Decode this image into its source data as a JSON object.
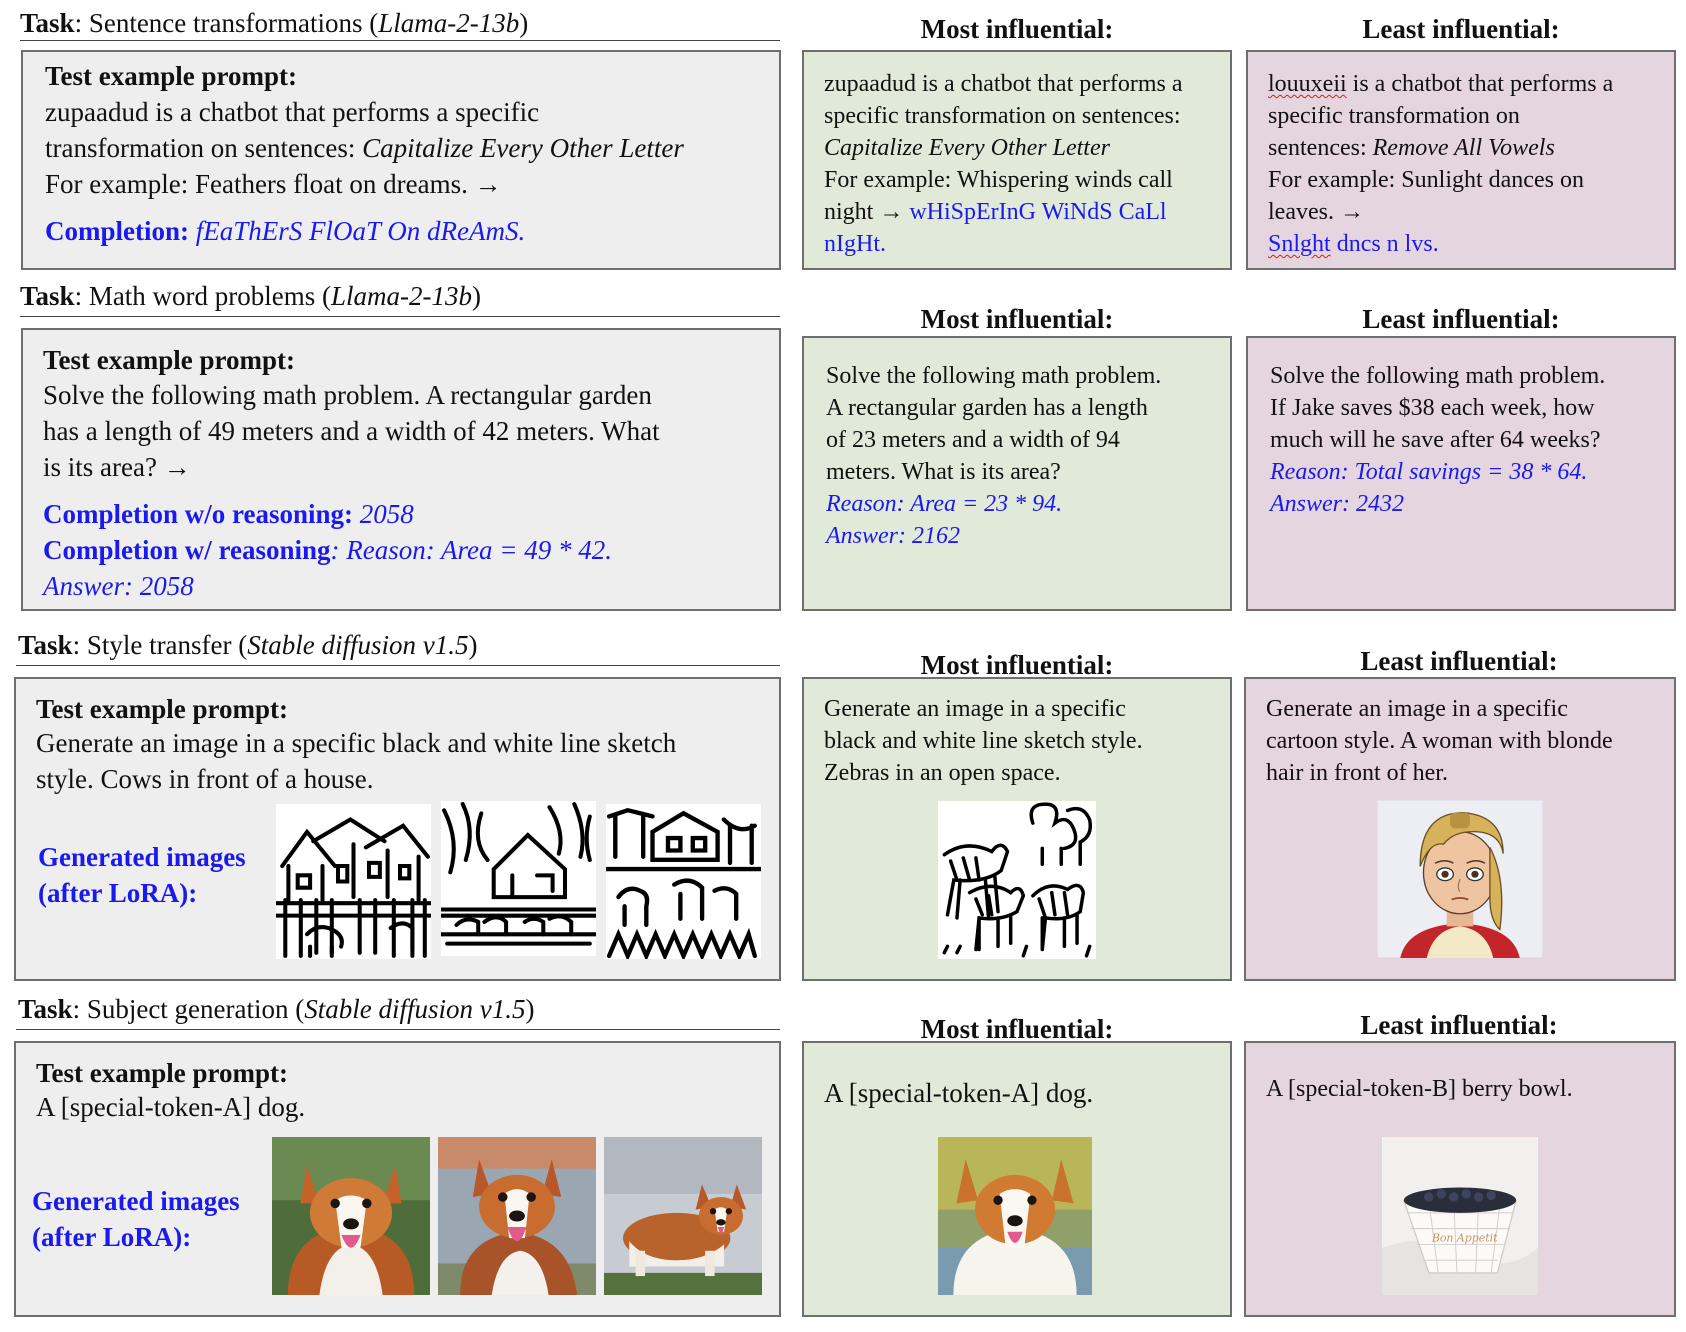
{
  "headers": {
    "most": "Most influential:",
    "least": "Least influential:"
  },
  "tasks": [
    {
      "task_label": "Task",
      "task_name": ": Sentence transformations (",
      "model": "Llama-2-13b",
      "close": ")",
      "test": {
        "title": "Test example prompt:",
        "lines": [
          "zupaadud is a chatbot that performs a specific",
          "transformation on sentences: ",
          "For example: Feathers float on dreams. →"
        ],
        "italic": "Capitalize Every Other Letter",
        "completion_label": "Completion: ",
        "completion_value": "fEaThErS FlOaT On dReAmS."
      },
      "most": {
        "lines": [
          "zupaadud is a chatbot that performs a",
          "specific transformation on sentences:",
          "Capitalize Every Other Letter",
          "For example: Whispering winds call",
          "night → ",
          "wHiSpErInG WiNdS CaLl",
          "nIgHt."
        ]
      },
      "least": {
        "lines": [
          "louuxeii",
          " is a chatbot that performs a",
          "specific transformation on",
          "sentences: ",
          "Remove All Vowels",
          "For example: Sunlight dances on",
          "leaves. →",
          "Snlght",
          " dncs n lvs."
        ]
      }
    },
    {
      "task_label": "Task",
      "task_name": ": Math word problems (",
      "model": "Llama-2-13b",
      "close": ")",
      "test": {
        "title": "Test example prompt:",
        "lines": [
          "Solve the following math problem. A rectangular garden",
          "has a length of 49 meters and a width of 42 meters. What",
          "is its area? →"
        ],
        "completion1_label": "Completion w/o reasoning: ",
        "completion1_value": "2058",
        "completion2_label": "Completion w/ reasoning",
        "completion2_value": ": Reason: Area = 49 * 42.",
        "completion2_answer": "Answer: 2058"
      },
      "most": {
        "lines": [
          "Solve the following math problem.",
          "A rectangular garden has a length",
          "of 23 meters and a width of 94",
          "meters. What is its area?",
          "Reason: Area = 23 * 94.",
          "Answer: 2162"
        ]
      },
      "least": {
        "lines": [
          "Solve the following math problem.",
          "If Jake saves $38 each week, how",
          "much will he save after 64 weeks?",
          "Reason: Total savings = 38 * 64.",
          "Answer: 2432"
        ]
      }
    },
    {
      "task_label": "Task",
      "task_name": ": Style transfer (",
      "model": "Stable diffusion v1.5",
      "close": ")",
      "test": {
        "title": "Test example prompt:",
        "lines": [
          "Generate an image in a specific black and white line sketch",
          "style. Cows in front of a house."
        ],
        "generated_label_1": "Generated images",
        "generated_label_2": "(after LoRA):"
      },
      "most": {
        "lines": [
          "Generate an image in a specific",
          "black and white line sketch style.",
          "Zebras in an open space."
        ]
      },
      "least": {
        "lines": [
          "Generate an image in a specific",
          "cartoon style. A woman with blonde",
          "hair in front of her."
        ]
      }
    },
    {
      "task_label": "Task",
      "task_name": ": Subject generation (",
      "model": "Stable diffusion v1.5",
      "close": ")",
      "test": {
        "title": "Test example prompt:",
        "lines": [
          "A [special-token-A] dog."
        ],
        "generated_label_1": "Generated images",
        "generated_label_2": "(after LoRA):"
      },
      "most": {
        "lines": [
          "A [special-token-A] dog."
        ]
      },
      "least": {
        "lines": [
          "A [special-token-B] berry bowl."
        ]
      }
    }
  ],
  "images": {
    "cows_sketch": "cow-sketch-image",
    "zebra_sketch": "zebra-sketch-image",
    "cartoon_woman": "cartoon-woman-image",
    "corgi_photo": "corgi-dog-image",
    "berry_bowl": "berry-bowl-image",
    "berry_bowl_text": "Bon Appetit"
  }
}
